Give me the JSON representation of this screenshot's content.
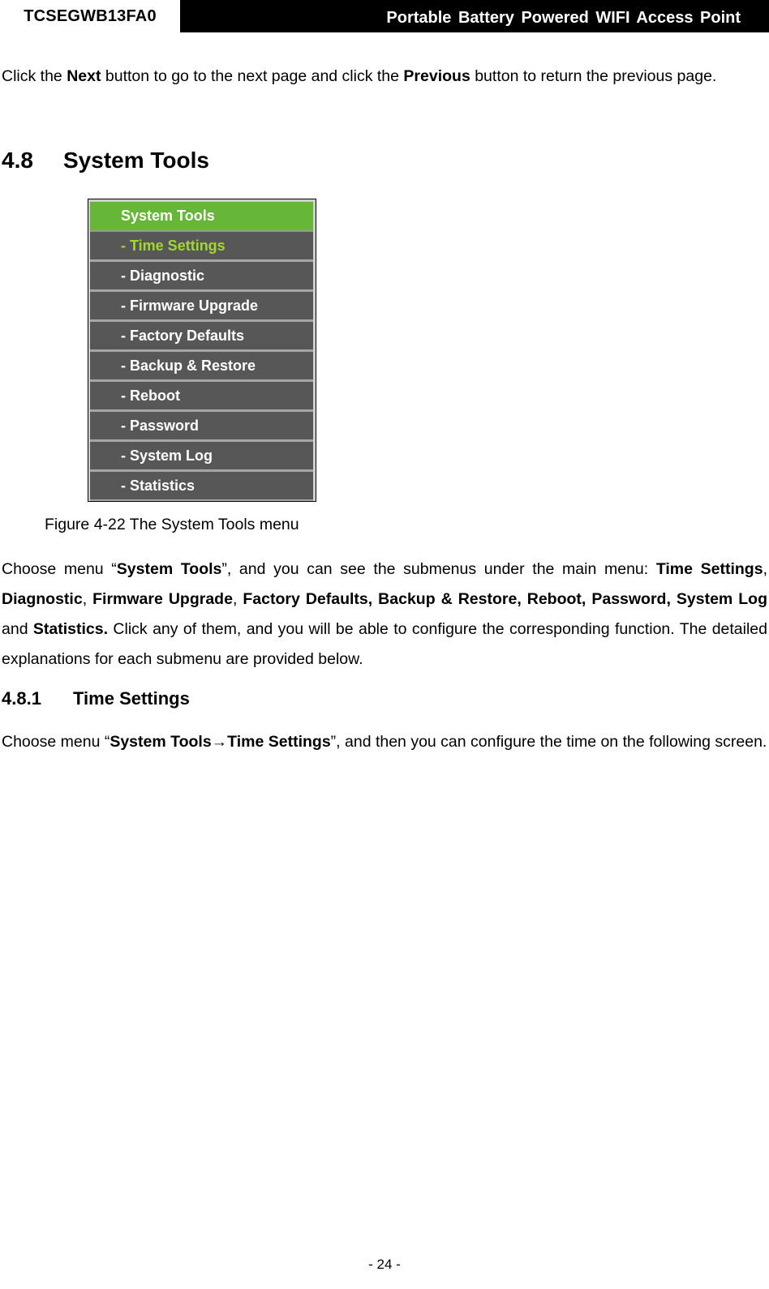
{
  "header": {
    "model": "TCSEGWB13FA0",
    "product": "Portable Battery Powered WIFI Access Point"
  },
  "intro": {
    "t1": "Click the ",
    "b1": "Next",
    "t2": " button to go to the next page and click the ",
    "b2": "Previous",
    "t3": " button to return the previous page."
  },
  "section": {
    "number": "4.8",
    "title": "System Tools"
  },
  "menu": {
    "header": "System Tools",
    "items": [
      "- Time Settings",
      "- Diagnostic",
      "- Firmware Upgrade",
      "- Factory Defaults",
      "- Backup & Restore",
      "- Reboot",
      "- Password",
      "- System Log",
      "- Statistics"
    ],
    "active_index": 0,
    "colors": {
      "header_bg": "#66b737",
      "item_bg": "#575757",
      "active_text": "#a2d82c",
      "divider": "#a6a6a6"
    }
  },
  "figure_caption": "Figure 4-22 The System Tools menu",
  "body": {
    "t1": "Choose menu “",
    "b1": "System Tools",
    "t2": "”, and you can see the submenus under the main menu: ",
    "b2": "Time Settings",
    "t3": ", ",
    "b3": "Diagnostic",
    "t4": ", ",
    "b4": "Firmware Upgrade",
    "t5": ", ",
    "b5": "Factory Defaults, Backup & Restore, Reboot, Password, System Log",
    "t6": " and ",
    "b6": "Statistics.",
    "t7": " Click any of them, and you will be able to configure the corresponding function. The detailed explanations for each submenu are provided below."
  },
  "subsection": {
    "number": "4.8.1",
    "title": "Time Settings"
  },
  "sub_body": {
    "t1": "Choose menu “",
    "b1": "System Tools→Time Settings",
    "t2": "”, and then you can configure the time on the following screen."
  },
  "footer": {
    "page": "- 24 -"
  }
}
